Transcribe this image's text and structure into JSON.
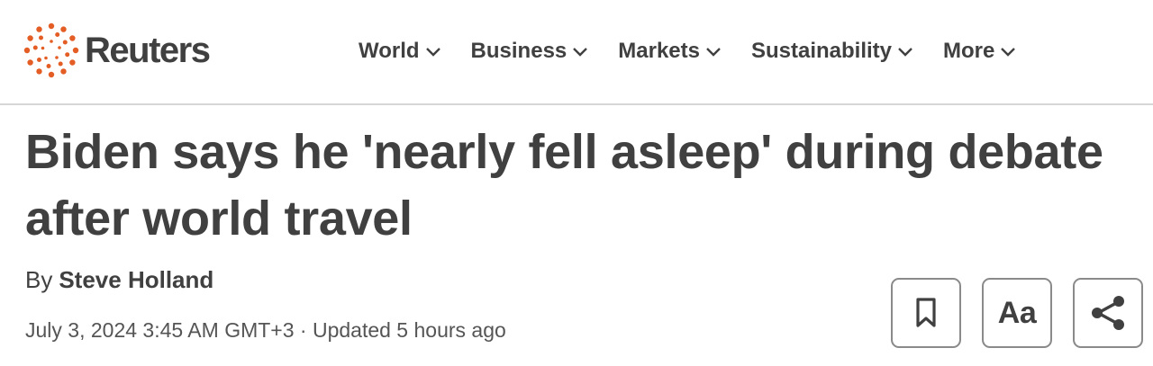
{
  "header": {
    "logo_text": "Reuters",
    "brand_color": "#e35d24",
    "nav": [
      {
        "label": "World",
        "icon": "chevron-down-icon"
      },
      {
        "label": "Business",
        "icon": "chevron-down-icon"
      },
      {
        "label": "Markets",
        "icon": "chevron-down-icon"
      },
      {
        "label": "Sustainability",
        "icon": "chevron-down-icon"
      },
      {
        "label": "More",
        "icon": "chevron-down-icon"
      }
    ]
  },
  "article": {
    "headline_line1": "Biden says he 'nearly fell asleep' during debate",
    "headline_line2": "after world travel",
    "byline_prefix": "By",
    "author": "Steve Holland",
    "date": "July 3, 2024 3:45 AM GMT+3 · Updated 5 hours ago"
  },
  "actions": {
    "bookmark_icon": "bookmark-icon",
    "font_size_label": "Aa",
    "share_icon": "share-icon"
  }
}
